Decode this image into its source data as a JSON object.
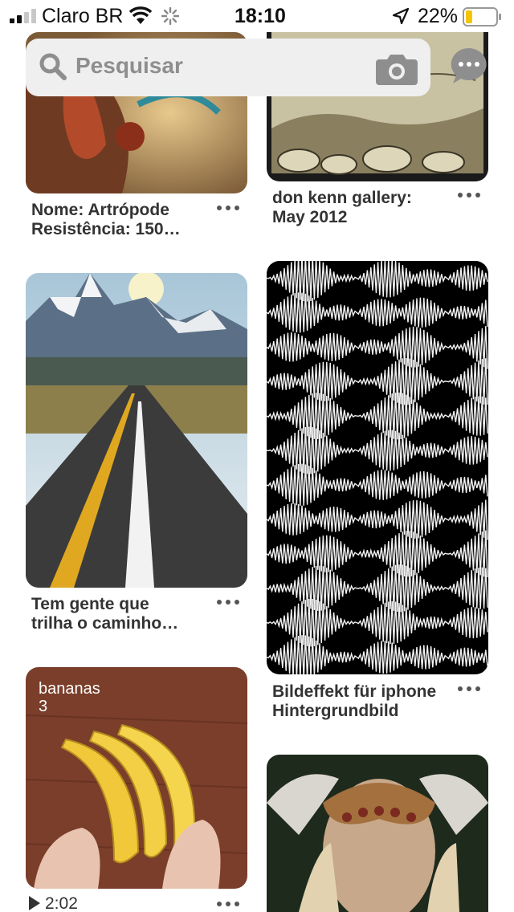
{
  "status_bar": {
    "carrier": "Claro BR",
    "time": "18:10",
    "battery": "22%",
    "battery_level": 0.22
  },
  "search": {
    "placeholder": "Pesquisar"
  },
  "pins": [
    {
      "title_line1": "Nome: Artrópode",
      "title_line2": "Resistência: 150…",
      "image": "fantasy-creature-art"
    },
    {
      "title_line1": "don kenn gallery:",
      "title_line2": "May 2012",
      "image": "ink-drawing-rocks"
    },
    {
      "title_line1": "Tem gente que",
      "title_line2": "trilha o caminho…",
      "image": "mountain-road"
    },
    {
      "title_line1": "Bildeffekt für iphone",
      "title_line2": "Hintergrundbild",
      "image": "sound-wave-pattern"
    },
    {
      "overlay_title": "bananas",
      "overlay_count": "3",
      "duration": "2:02",
      "image": "bananas-video"
    },
    {
      "image": "horned-girl-painting"
    }
  ],
  "icons": {
    "search": "search-icon",
    "camera": "camera-icon",
    "messages": "message-icon",
    "more": "more-dots-icon"
  }
}
